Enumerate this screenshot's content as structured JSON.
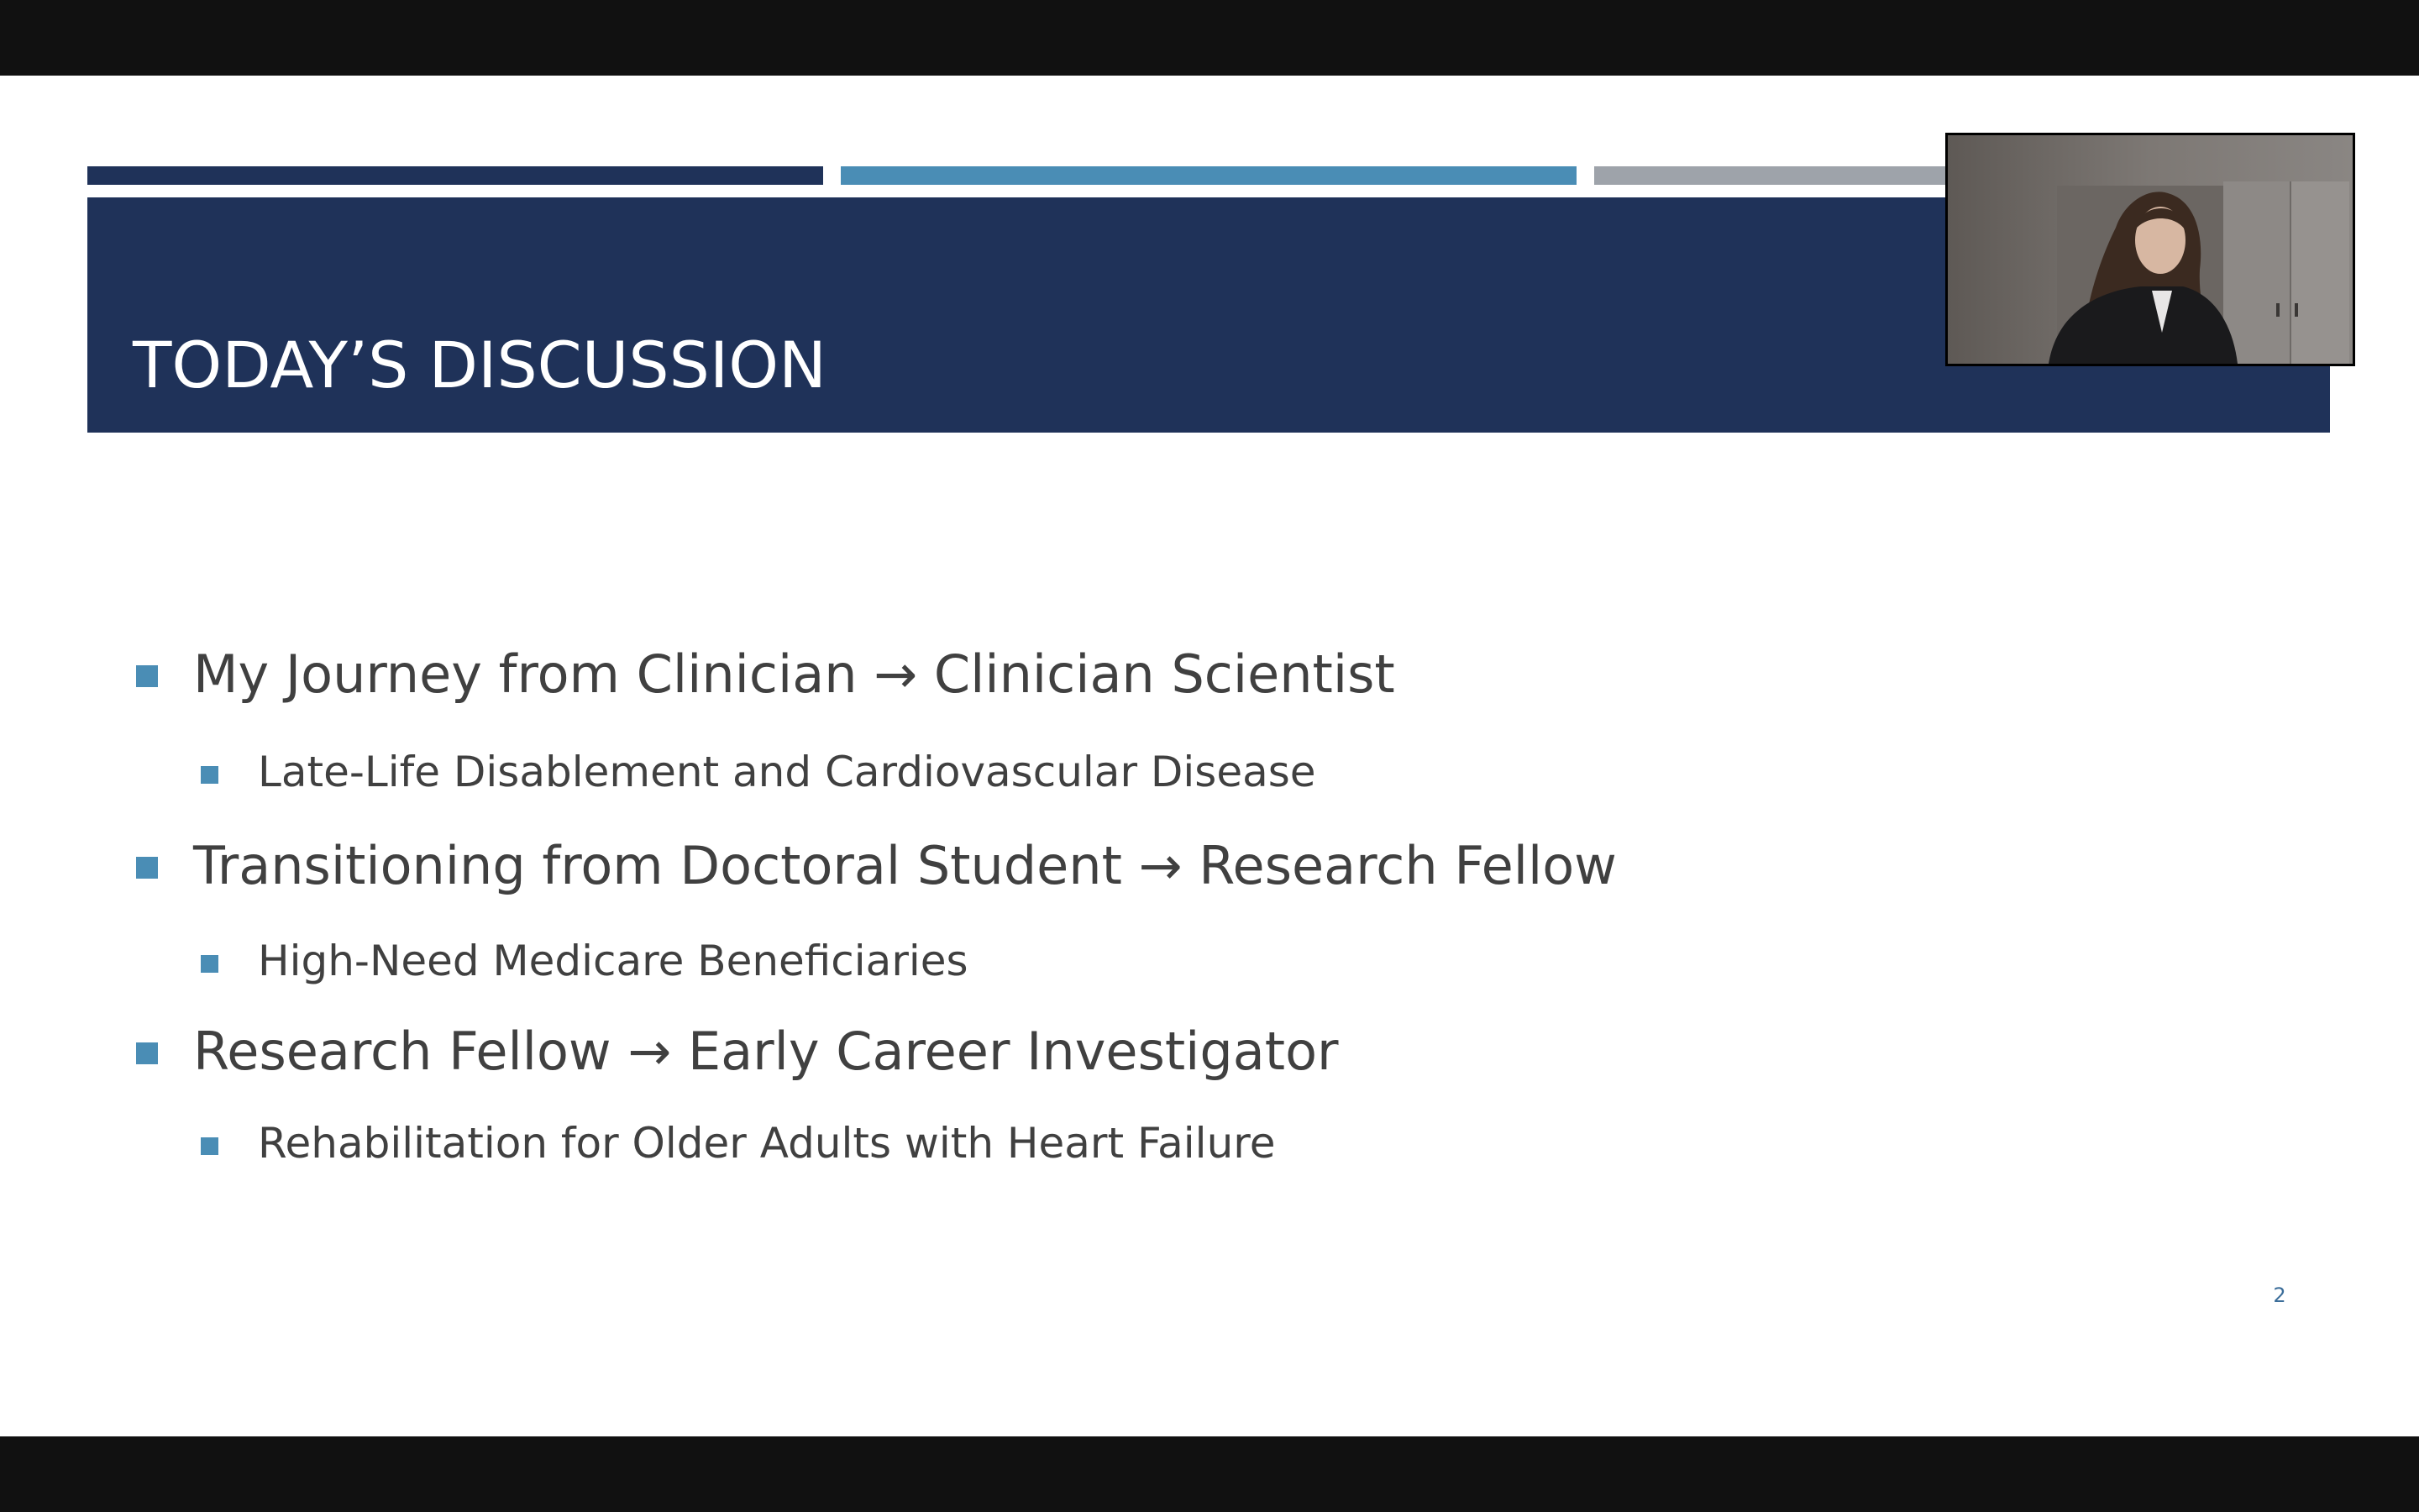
{
  "colors": {
    "navy": "#1f3259",
    "accent_blue": "#4a8db5",
    "accent_gray": "#9ea3aa",
    "text": "#404040",
    "letterbox": "#111111"
  },
  "slide": {
    "title": "TODAY’S DISCUSSION",
    "page_number": "2",
    "bullets": [
      {
        "level": 1,
        "text": "My Journey from Clinician → Clinician Scientist"
      },
      {
        "level": 2,
        "text": "Late-Life Disablement and Cardiovascular Disease"
      },
      {
        "level": 1,
        "text": "Transitioning from Doctoral Student → Research Fellow"
      },
      {
        "level": 2,
        "text": "High-Need Medicare Beneficiaries"
      },
      {
        "level": 1,
        "text": "Research Fellow → Early Career Investigator"
      },
      {
        "level": 2,
        "text": "Rehabilitation for Older Adults with Heart Failure"
      }
    ]
  },
  "webcam": {
    "icon": "presenter-video"
  }
}
